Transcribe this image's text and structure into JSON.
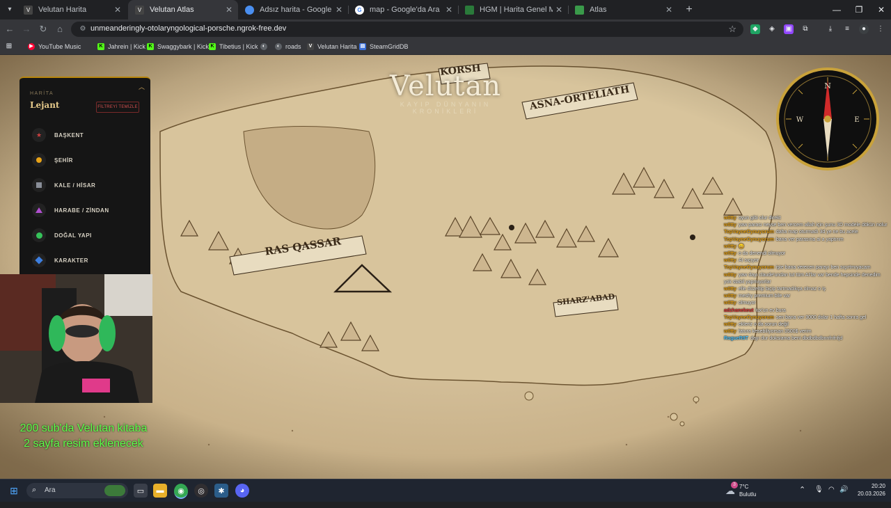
{
  "browser": {
    "tabs": [
      {
        "label": "Velutan Harita",
        "active": false,
        "icon": "velutan-favicon"
      },
      {
        "label": "Velutan Atlas",
        "active": true,
        "icon": "velutan-favicon"
      },
      {
        "label": "Adsız harita - Google Earth",
        "active": false,
        "icon": "google-earth-icon"
      },
      {
        "label": "map - Google'da Ara",
        "active": false,
        "icon": "google-icon"
      },
      {
        "label": "HGM | Harita Genel Müdürlüğü",
        "active": false,
        "icon": "hgm-icon"
      },
      {
        "label": "Atlas",
        "active": false,
        "icon": "atlas-icon"
      }
    ],
    "url": "unmeanderingly-otolaryngological-porsche.ngrok-free.dev",
    "bookmarks": [
      {
        "label": "YouTube Music",
        "icon": "youtube-music-icon",
        "color": "#ff0033"
      },
      {
        "label": "Jahrein | Kick",
        "icon": "kick-icon",
        "color": "#53fc18"
      },
      {
        "label": "Swaggybark | Kick",
        "icon": "kick-icon",
        "color": "#53fc18"
      },
      {
        "label": "Tibetius | Kick",
        "icon": "kick-icon",
        "color": "#53fc18"
      },
      {
        "label": "",
        "icon": "globe-icon",
        "color": "#9aa0a6"
      },
      {
        "label": "roads",
        "icon": "globe-icon",
        "color": "#9aa0a6"
      },
      {
        "label": "Velutan Harita",
        "icon": "velutan-favicon",
        "color": "#444"
      },
      {
        "label": "SteamGridDB",
        "icon": "steamgriddb-icon",
        "color": "#3a6fd8"
      }
    ]
  },
  "map": {
    "brand": "Velutan",
    "tagline": "KAYIP DÜNYANIN KRONİKLERİ",
    "regions": {
      "korsh": "KORSH",
      "asna": "ASNA-ORTELIATH",
      "ras_qassar": "RAS QASSAR",
      "sharz_abad": "SHARZ'ABAD"
    }
  },
  "legend": {
    "kicker": "HARİTA",
    "title": "Lejant",
    "clear_button": "FİLTREYİ TEMİZLE",
    "items": [
      {
        "label": "BAŞKENT",
        "icon": "star-icon",
        "color": "#d04040"
      },
      {
        "label": "ŞEHİR",
        "icon": "circle-icon",
        "color": "#e8a317"
      },
      {
        "label": "KALE / HİSAR",
        "icon": "square-icon",
        "color": "#8a8f99"
      },
      {
        "label": "HARABE / ZİNDAN",
        "icon": "triangle-icon",
        "color": "#b04fd0"
      },
      {
        "label": "DOĞAL YAPI",
        "icon": "circle-icon",
        "color": "#36c25a"
      },
      {
        "label": "KARAKTER",
        "icon": "diamond-icon",
        "color": "#3d7fe0"
      }
    ]
  },
  "compass": {
    "n": "N",
    "e": "E",
    "w": "W"
  },
  "overlay": {
    "line1": "200 sub'da Velutan kitaba",
    "line2": "2 sayfa resim eklenecek"
  },
  "chat": [
    {
      "user": "w0tty",
      "color": "#e8a317",
      "text": "oyun gibi olur direkt"
    },
    {
      "user": "w0tty",
      "color": "#e8a317",
      "text": "yaw parası neyse ben vercem allah için şunu 3D modele dökün nolur"
    },
    {
      "user": "TopVayneOynuyorum",
      "color": "#e8a317",
      "text": "daha map oturmadı 3d ye ne bu acele"
    },
    {
      "user": "TopVayneOynuyorum",
      "color": "#e8a317",
      "text": "bana ver parasına ai a yaptırım"
    },
    {
      "user": "w0tty",
      "color": "#e8a317",
      "text": "😄"
    },
    {
      "user": "w0tty",
      "color": "#e8a317",
      "text": "o da denendi olmuyor"
    },
    {
      "user": "w0tty",
      "color": "#e8a317",
      "text": "AI sıçıyor"
    },
    {
      "user": "TopVayneOynuyorum",
      "color": "#e8a317",
      "text": "işte bana verecen parayı ben sıçırtmıyacam"
    },
    {
      "user": "w0tty",
      "color": "#e8a317",
      "text": "yaw dayı claude'undan tut tüm AI'lar var bende hepsinde denedim yok stabil yapmıyorlar"
    },
    {
      "user": "w0tty",
      "color": "#e8a317",
      "text": "elle düzeltip biçip tartmadıkça olmaz o iş"
    },
    {
      "user": "w0tty",
      "color": "#e8a317",
      "text": "meshy premium bile var"
    },
    {
      "user": "w0tty",
      "color": "#e8a317",
      "text": "olmuyor"
    },
    {
      "user": "adzhanekeut",
      "color": "#e03a3a",
      "text": "lux'un ev bura"
    },
    {
      "user": "TopVayneOynuyorum",
      "color": "#e8a317",
      "text": "sen bana ver 3000 dolar 1 hafta sonra gel"
    },
    {
      "user": "w0tty",
      "color": "#e8a317",
      "text": "ekleriz o da sorun değil"
    },
    {
      "user": "w0tty",
      "color": "#e8a317",
      "text": "fatura kesebiliyorsan 3500$ verim"
    },
    {
      "user": "RogueR9T",
      "color": "#58c8ff",
      "text": "dayı dur doksiama beni dbdbdbdbnnfnfnfjd"
    }
  ],
  "taskbar": {
    "search_placeholder": "Ara",
    "weather_temp": "7°C",
    "weather_desc": "Bulutlu",
    "weather_badge": "3",
    "time": "20:20",
    "date": "20.03.2026"
  }
}
